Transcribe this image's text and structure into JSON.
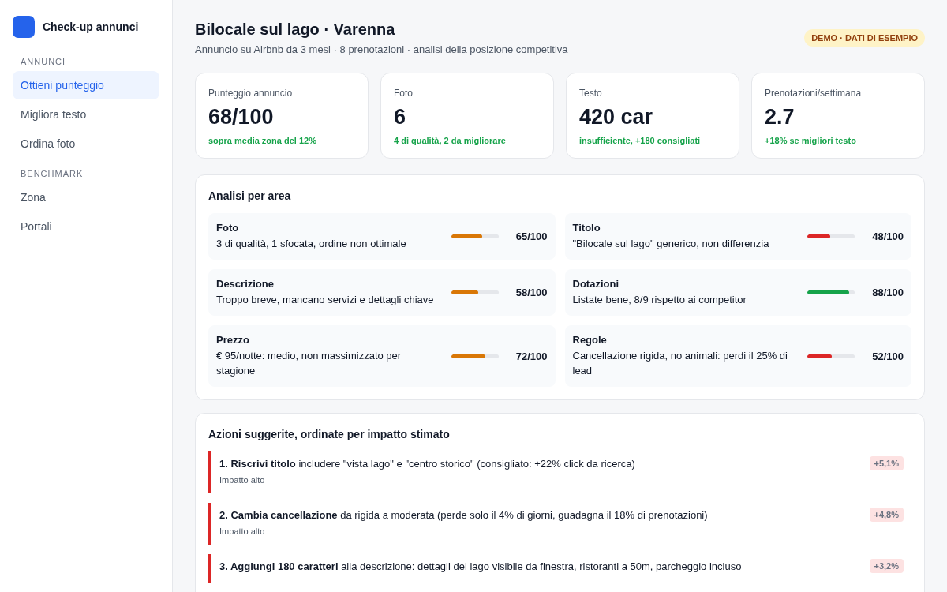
{
  "app": {
    "title": "Check-up annunci"
  },
  "sidebar": {
    "sections": [
      {
        "heading": "ANNUNCI",
        "items": [
          {
            "label": "Ottieni punteggio",
            "selected": true
          },
          {
            "label": "Migliora testo",
            "selected": false
          },
          {
            "label": "Ordina foto",
            "selected": false
          }
        ]
      },
      {
        "heading": "BENCHMARK",
        "items": [
          {
            "label": "Zona",
            "selected": false
          },
          {
            "label": "Portali",
            "selected": false
          }
        ]
      }
    ]
  },
  "header": {
    "title": "Bilocale sul lago · Varenna",
    "subtitle": "Annuncio su Airbnb da 3 mesi · 8 prenotazioni · analisi della posizione competitiva",
    "badge": "DEMO · DATI DI ESEMPIO"
  },
  "stats": [
    {
      "label": "Punteggio annuncio",
      "value": "68/100",
      "note": "sopra media zona del 12%"
    },
    {
      "label": "Foto",
      "value": "6",
      "note": "4 di qualità, 2 da migliorare"
    },
    {
      "label": "Testo",
      "value": "420 car",
      "note": "insufficiente, +180 consigliati"
    },
    {
      "label": "Prenotazioni/settimana",
      "value": "2.7",
      "note": "+18% se migliori testo"
    }
  ],
  "analysis": {
    "title": "Analisi per area",
    "areas": [
      {
        "name": "Foto",
        "text": "3 di qualità, 1 sfocata, ordine non ottimale",
        "level": 0.65,
        "score": "65/100",
        "color": "#d97706"
      },
      {
        "name": "Titolo",
        "text": "\"Bilocale sul lago\" generico, non differenzia",
        "level": 0.48,
        "score": "48/100",
        "color": "#dc2626"
      },
      {
        "name": "Descrizione",
        "text": "Troppo breve, mancano servizi e dettagli chiave",
        "level": 0.58,
        "score": "58/100",
        "color": "#d97706"
      },
      {
        "name": "Dotazioni",
        "text": "Listate bene, 8/9 rispetto ai competitor",
        "level": 0.88,
        "score": "88/100",
        "color": "#16a34a"
      },
      {
        "name": "Prezzo",
        "text": "€ 95/notte: medio, non massimizzato per stagione",
        "level": 0.72,
        "score": "72/100",
        "color": "#d97706"
      },
      {
        "name": "Regole",
        "text": "Cancellazione rigida, no animali: perdi il 25% di lead",
        "level": 0.52,
        "score": "52/100",
        "color": "#dc2626"
      }
    ]
  },
  "actions": {
    "title": "Azioni suggerite, ordinate per impatto stimato",
    "items": [
      {
        "text": "**1. Riscrivi titolo** includere \"vista lago\" e \"centro storico\" (consigliato: +22% click da ricerca)",
        "impact": "Impatto alto",
        "gain": "+5,1%",
        "color": "#dc2626"
      },
      {
        "text": "**2. Cambia cancellazione** da rigida a moderata (perde solo il 4% di giorni, guadagna il 18% di prenotazioni)",
        "impact": "Impatto alto",
        "gain": "+4,8%",
        "color": "#dc2626"
      },
      {
        "text": "**3. Aggiungi 180 caratteri** alla descrizione: dettagli del lago visibile da finestra, ristoranti a 50m, parcheggio incluso",
        "gain": "+3,2%",
        "color": "#dc2626"
      }
    ]
  }
}
